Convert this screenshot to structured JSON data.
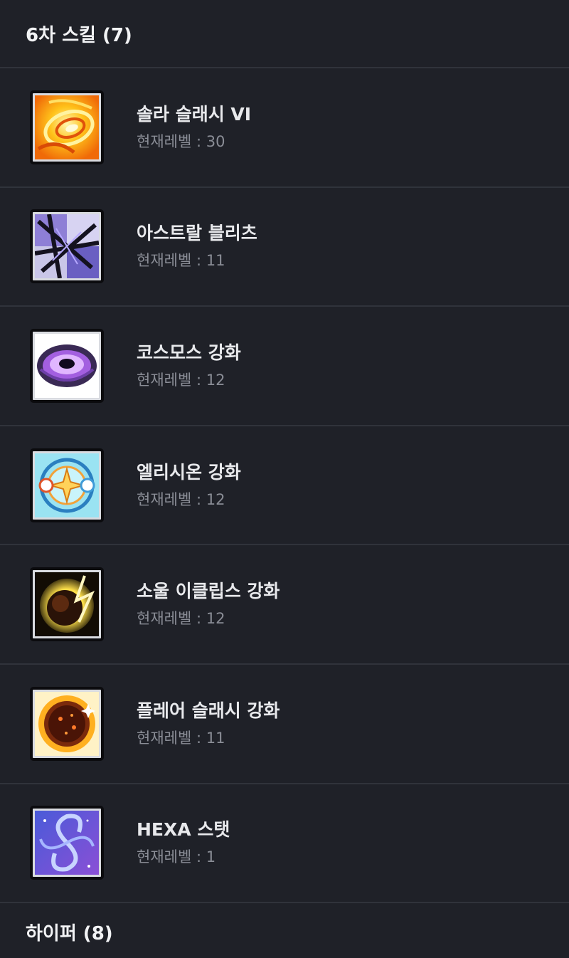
{
  "sixth_section": {
    "title": "6차 스킬 (7)"
  },
  "level_prefix": "현재레벨 : ",
  "skills": [
    {
      "name": "솔라 슬래시 VI",
      "level": "현재레벨 : 30",
      "icon": "solar-slash-icon"
    },
    {
      "name": "아스트랄 블리츠",
      "level": "현재레벨 : 11",
      "icon": "astral-blitz-icon"
    },
    {
      "name": "코스모스 강화",
      "level": "현재레벨 : 12",
      "icon": "cosmos-enhance-icon"
    },
    {
      "name": "엘리시온 강화",
      "level": "현재레벨 : 12",
      "icon": "elysion-enhance-icon"
    },
    {
      "name": "소울 이클립스 강화",
      "level": "현재레벨 : 12",
      "icon": "soul-eclipse-enhance-icon"
    },
    {
      "name": "플레어 슬래시 강화",
      "level": "현재레벨 : 11",
      "icon": "flare-slash-enhance-icon"
    },
    {
      "name": "HEXA 스탯",
      "level": "현재레벨 : 1",
      "icon": "hexa-stat-icon"
    }
  ],
  "hyper_section": {
    "title": "하이퍼 (8)"
  },
  "colors": {
    "background": "#1f2128",
    "divider": "#30333b",
    "title_text": "#e8e9ec",
    "sub_text": "#8a8d96"
  }
}
